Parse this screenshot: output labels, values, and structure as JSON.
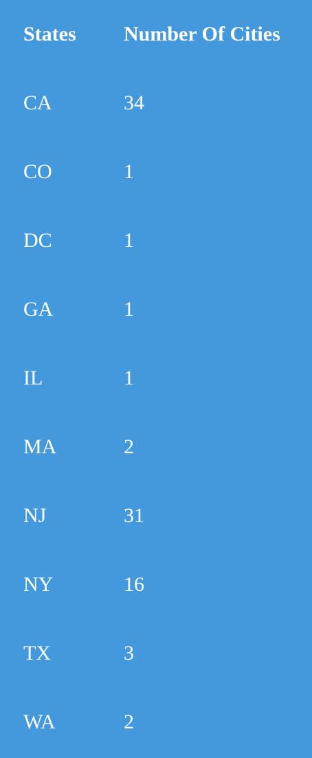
{
  "table": {
    "headers": {
      "state": "States",
      "count": "Number Of Cities"
    },
    "rows": [
      {
        "state": "CA",
        "count": "34"
      },
      {
        "state": "CO",
        "count": "1"
      },
      {
        "state": "DC",
        "count": "1"
      },
      {
        "state": "GA",
        "count": "1"
      },
      {
        "state": "IL",
        "count": "1"
      },
      {
        "state": "MA",
        "count": "2"
      },
      {
        "state": "NJ",
        "count": "31"
      },
      {
        "state": "NY",
        "count": "16"
      },
      {
        "state": "TX",
        "count": "3"
      },
      {
        "state": "WA",
        "count": "2"
      }
    ]
  },
  "colors": {
    "background": "#4399db",
    "text": "#ffffff"
  }
}
